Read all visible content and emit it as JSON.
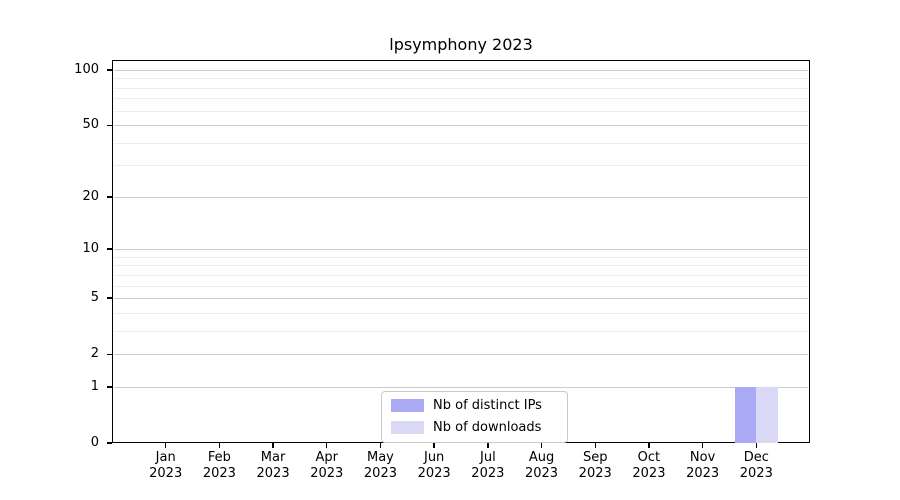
{
  "figure": {
    "title": "lpsymphony 2023"
  },
  "chart_data": {
    "type": "bar",
    "title": "lpsymphony 2023",
    "categories": [
      "Jan 2023",
      "Feb 2023",
      "Mar 2023",
      "Apr 2023",
      "May 2023",
      "Jun 2023",
      "Jul 2023",
      "Aug 2023",
      "Sep 2023",
      "Oct 2023",
      "Nov 2023",
      "Dec 2023"
    ],
    "series": [
      {
        "name": "Nb of distinct IPs",
        "color": "#a9a9f4",
        "values": [
          0,
          0,
          0,
          0,
          0,
          0,
          0,
          0,
          0,
          0,
          0,
          1
        ]
      },
      {
        "name": "Nb of downloads",
        "color": "#d9d9f6",
        "values": [
          0,
          0,
          0,
          0,
          0,
          0,
          0,
          0,
          0,
          0,
          0,
          1
        ]
      }
    ],
    "yscale": "log1p",
    "ylim": [
      0,
      100
    ],
    "yticks": [
      0,
      1,
      2,
      5,
      10,
      20,
      50,
      100
    ],
    "minor_yticks": [
      3,
      4,
      6,
      7,
      8,
      9,
      30,
      40,
      60,
      70,
      80,
      90
    ],
    "grid": "horizontal-only",
    "legend_position": "lower-center-inside",
    "axis_color": "#000000",
    "major_grid_color": "#cccccc",
    "minor_grid_color": "#ededed"
  }
}
